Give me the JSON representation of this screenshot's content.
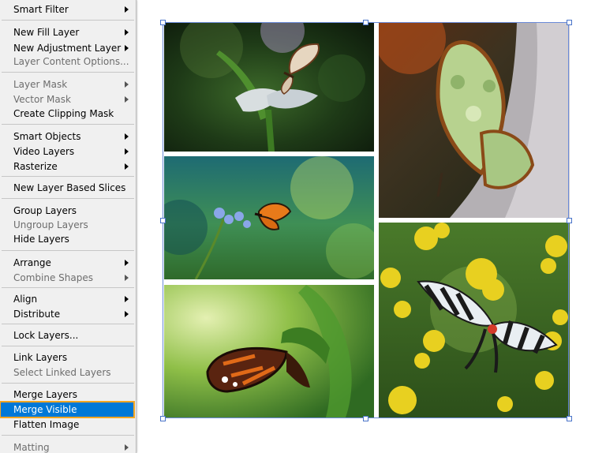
{
  "menu": {
    "items": [
      {
        "label": "Smart Filter",
        "submenu": true,
        "disabled": false
      },
      {
        "label": "New Fill Layer",
        "submenu": true,
        "disabled": false
      },
      {
        "label": "New Adjustment Layer",
        "submenu": true,
        "disabled": false
      },
      {
        "label": "Layer Content Options...",
        "submenu": false,
        "disabled": true
      },
      {
        "label": "Layer Mask",
        "submenu": true,
        "disabled": true
      },
      {
        "label": "Vector Mask",
        "submenu": true,
        "disabled": true
      },
      {
        "label": "Create Clipping Mask",
        "submenu": false,
        "disabled": false
      },
      {
        "label": "Smart Objects",
        "submenu": true,
        "disabled": false
      },
      {
        "label": "Video Layers",
        "submenu": true,
        "disabled": false
      },
      {
        "label": "Rasterize",
        "submenu": true,
        "disabled": false
      },
      {
        "label": "New Layer Based Slices",
        "submenu": false,
        "disabled": false
      },
      {
        "label": "Group Layers",
        "submenu": false,
        "disabled": false
      },
      {
        "label": "Ungroup Layers",
        "submenu": false,
        "disabled": true
      },
      {
        "label": "Hide Layers",
        "submenu": false,
        "disabled": false
      },
      {
        "label": "Arrange",
        "submenu": true,
        "disabled": false
      },
      {
        "label": "Combine Shapes",
        "submenu": true,
        "disabled": true
      },
      {
        "label": "Align",
        "submenu": true,
        "disabled": false
      },
      {
        "label": "Distribute",
        "submenu": true,
        "disabled": false
      },
      {
        "label": "Lock Layers...",
        "submenu": false,
        "disabled": false
      },
      {
        "label": "Link Layers",
        "submenu": false,
        "disabled": false
      },
      {
        "label": "Select Linked Layers",
        "submenu": false,
        "disabled": true
      },
      {
        "label": "Merge Layers",
        "submenu": false,
        "disabled": false
      },
      {
        "label": "Merge Visible",
        "submenu": false,
        "disabled": false,
        "highlighted": true
      },
      {
        "label": "Flatten Image",
        "submenu": false,
        "disabled": false
      },
      {
        "label": "Matting",
        "submenu": true,
        "disabled": true
      }
    ]
  },
  "canvas": {
    "tiles": [
      {
        "name": "glasswing-butterfly-on-flower"
      },
      {
        "name": "malachite-butterfly-on-rock"
      },
      {
        "name": "butterfly-on-blue-flowers"
      },
      {
        "name": "zebra-swallowtail-on-yellow-flowers"
      },
      {
        "name": "orange-striped-butterfly-on-leaf"
      }
    ]
  },
  "colors": {
    "highlight": "#0078d7",
    "highlight_outline": "#f5a623",
    "selection_border": "#6a8ad8"
  }
}
